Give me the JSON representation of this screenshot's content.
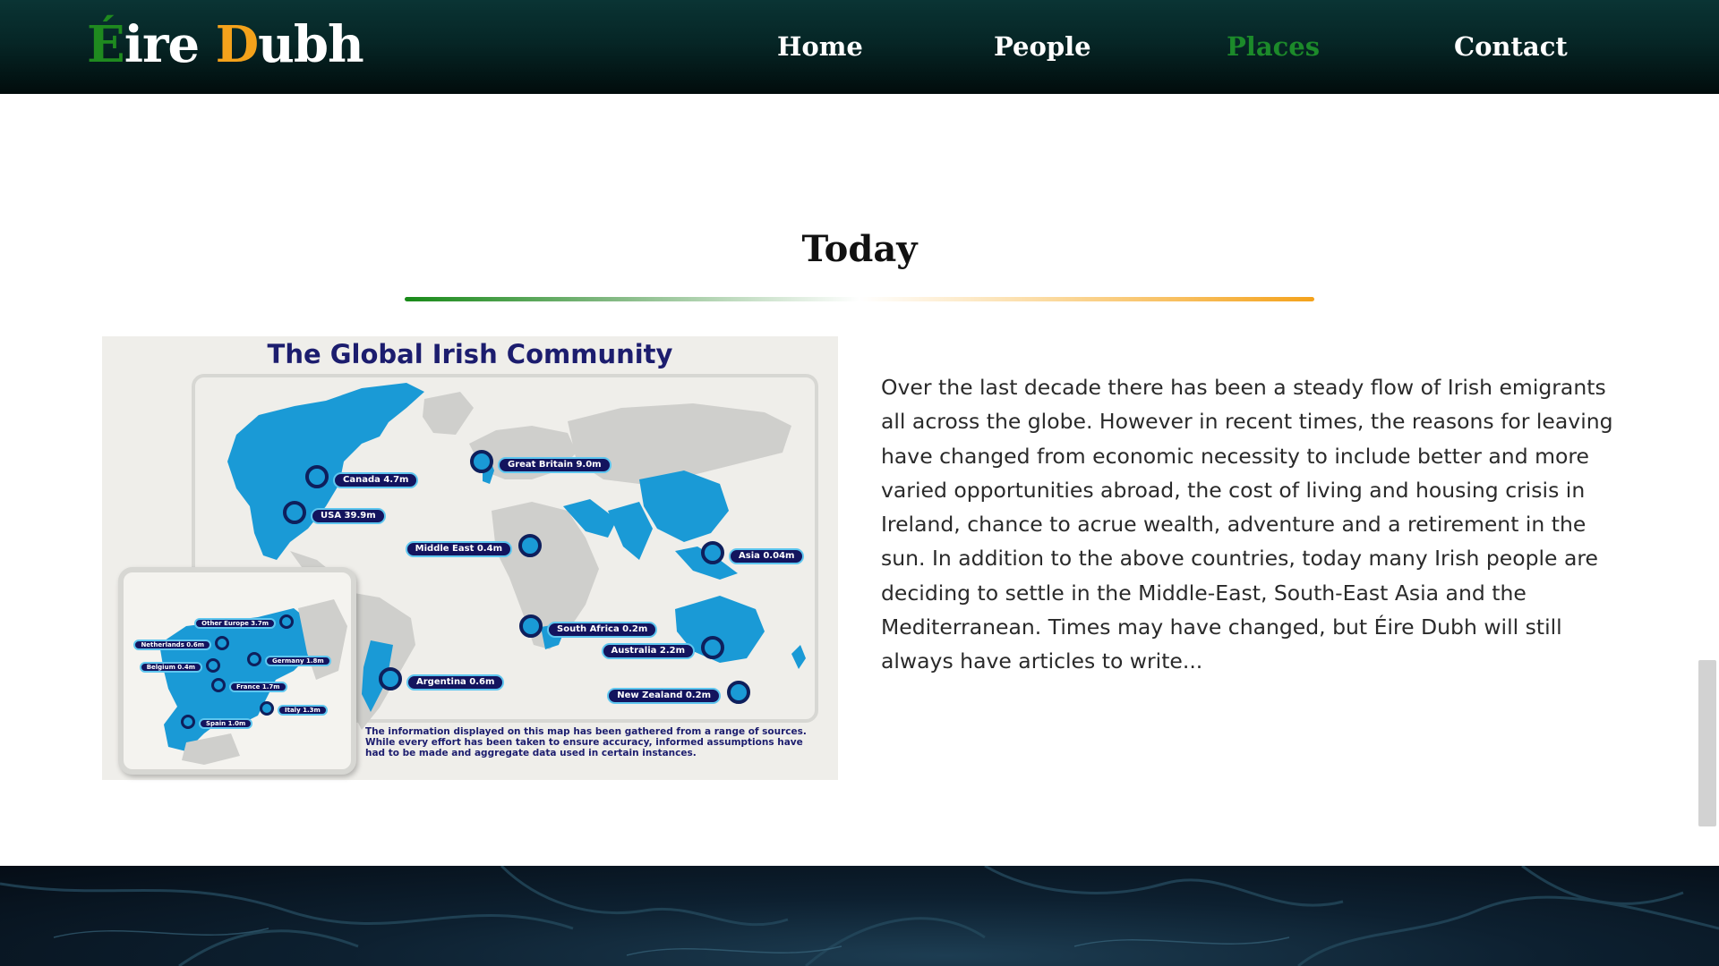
{
  "header": {
    "logo": {
      "part1": "É",
      "part2": "ire ",
      "part3": "D",
      "part4": "ubh"
    },
    "nav": [
      {
        "label": "Home",
        "active": false
      },
      {
        "label": "People",
        "active": false
      },
      {
        "label": "Places",
        "active": true
      },
      {
        "label": "Contact",
        "active": false
      }
    ]
  },
  "section": {
    "title": "Today",
    "body": "Over the last decade there has been a steady flow of Irish emigrants all across the globe. However in recent times, the reasons for leaving have changed from economic necessity to include better and more varied opportunities abroad, the cost of living and housing crisis in Ireland, chance to acrue wealth, adventure and a retirement in the sun. In addition to the above countries, today many Irish people are deciding to settle in the Middle-East, South-East Asia and the Mediterranean. Times may have changed, but Éire Dubh will still always have articles to write..."
  },
  "map": {
    "title": "The Global Irish Community",
    "note": "The information displayed on this map has been gathered from a range of sources. While every effort has been taken to ensure accuracy, informed assumptions have had to be made and aggregate data used in certain instances.",
    "pins": [
      {
        "label": "Canada 4.7m"
      },
      {
        "label": "USA 39.9m"
      },
      {
        "label": "Great Britain 9.0m"
      },
      {
        "label": "Middle East 0.4m"
      },
      {
        "label": "Asia 0.04m"
      },
      {
        "label": "South Africa 0.2m"
      },
      {
        "label": "Australia 2.2m"
      },
      {
        "label": "New Zealand 0.2m"
      },
      {
        "label": "Argentina 0.6m"
      }
    ],
    "inset_pins": [
      {
        "label": "Other Europe 3.7m"
      },
      {
        "label": "Netherlands 0.6m"
      },
      {
        "label": "Belgium 0.4m"
      },
      {
        "label": "Germany 1.8m"
      },
      {
        "label": "France 1.7m"
      },
      {
        "label": "Italy 1.3m"
      },
      {
        "label": "Spain 1.0m"
      }
    ]
  },
  "colors": {
    "header_bg": "#062626",
    "nav_active": "#1c8a2a",
    "logo_green": "#1f8a1f",
    "logo_orange": "#f4a21b",
    "map_blue": "#1a9ad6",
    "map_navy": "#1c1d6e"
  }
}
